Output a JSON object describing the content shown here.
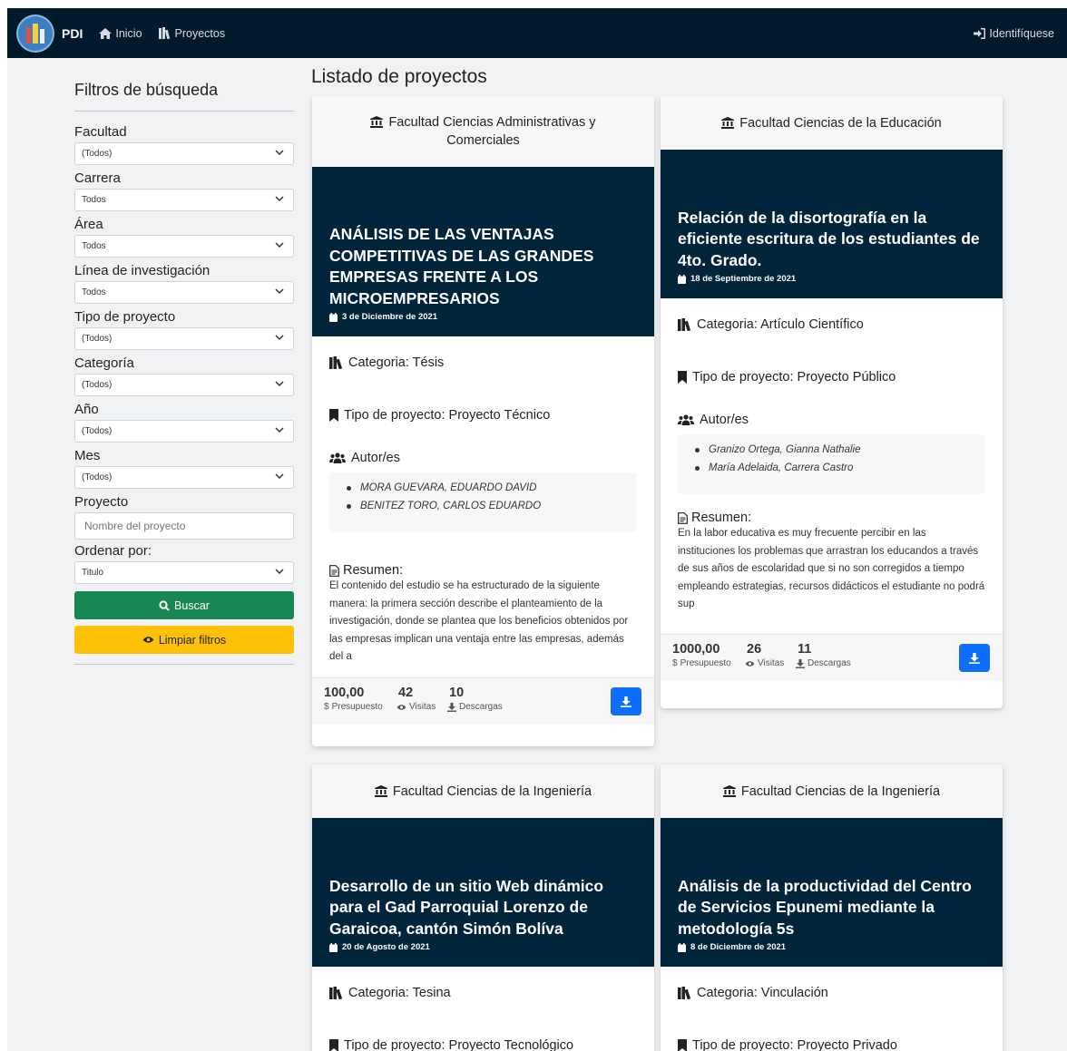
{
  "navbar": {
    "brand": "PDI",
    "links": [
      {
        "label": "Inicio",
        "icon": "home-icon"
      },
      {
        "label": "Proyectos",
        "icon": "books-icon"
      }
    ],
    "login_label": "Identifíquese"
  },
  "sidebar": {
    "title": "Filtros de búsqueda",
    "filters": [
      {
        "label": "Facultad",
        "value": "(Todos)"
      },
      {
        "label": "Carrera",
        "value": "Todos"
      },
      {
        "label": "Área",
        "value": "Todos"
      },
      {
        "label": "Línea de investigación",
        "value": "Todos"
      },
      {
        "label": "Tipo de proyecto",
        "value": "(Todos)"
      },
      {
        "label": "Categoría",
        "value": "(Todos)"
      },
      {
        "label": "Año",
        "value": "(Todos)"
      },
      {
        "label": "Mes",
        "value": "(Todos)"
      }
    ],
    "project_label": "Proyecto",
    "project_placeholder": "Nombre del proyecto",
    "order_label": "Ordenar por:",
    "order_value": "Titulo",
    "search_button": "Buscar",
    "clear_button": "Limpiar filtros"
  },
  "main": {
    "title": "Listado de proyectos",
    "labels": {
      "categoria_prefix": "Categoria: ",
      "tipo_prefix": "Tipo de proyecto: ",
      "autores": "Autor/es",
      "resumen": "Resumen:",
      "presupuesto": "Presupuesto",
      "visitas": "Visitas",
      "descargas": "Descargas"
    },
    "cards": [
      {
        "faculty": "Facultad Ciencias Administrativas y Comerciales",
        "title": "ANÁLISIS DE LAS VENTAJAS COMPETITIVAS DE LAS GRANDES EMPRESAS FRENTE A LOS MICROEMPRESARIOS",
        "date": "3 de Diciembre de 2021",
        "categoria": "Categoria: Tésis",
        "tipo": "Tipo de proyecto: Proyecto Técnico",
        "authors": [
          "MORA GUEVARA, EDUARDO DAVID",
          "BENITEZ TORO, CARLOS EDUARDO"
        ],
        "resumen": "El contenido del estudio se ha estructurado de la siguiente manera: la primera sección describe el planteamiento de la investigación, donde se plantea que los beneficios obtenidos por las empresas implican una ventaja entre las empresas, además del a",
        "presupuesto": "100,00",
        "visitas": "42",
        "descargas": "10"
      },
      {
        "faculty": "Facultad Ciencias de la Educación",
        "title": "Relación de la disortografía en la eficiente escritura de los estudiantes de 4to. Grado.",
        "date": "18 de Septiembre de 2021",
        "categoria": "Categoria: Artículo Científico",
        "tipo": "Tipo de proyecto: Proyecto Público",
        "authors": [
          "Granizo Ortega, Gianna Nathalie",
          "María Adelaida, Carrera Castro"
        ],
        "resumen": "En la labor educativa es muy frecuente percibir en las instituciones los problemas que arrastran los educandos a través de sus años de escolaridad que si no son corregidos a tiempo empleando estrategias, recursos didácticos el estudiante no podrá sup",
        "presupuesto": "1000,00",
        "visitas": "26",
        "descargas": "11"
      },
      {
        "faculty": "Facultad Ciencias de la Ingeniería",
        "title": "Desarrollo de un sitio Web dinámico para el Gad Parroquial Lorenzo de Garaicoa, cantón Simón Bolíva",
        "date": "20 de Agosto de 2021",
        "categoria": "Categoria: Tesina",
        "tipo": "Tipo de proyecto: Proyecto Tecnológico"
      },
      {
        "faculty": "Facultad Ciencias de la Ingeniería",
        "title": "Análisis de la productividad del Centro de Servicios Epunemi mediante la metodología 5s",
        "date": "8 de Diciembre de 2021",
        "categoria": "Categoria: Vinculación",
        "tipo": "Tipo de proyecto: Proyecto Privado"
      }
    ]
  },
  "colors": {
    "navbar": "#001a2b",
    "hero": "#00243a",
    "search_button": "#198754",
    "clear_button": "#ffc107",
    "download_button": "#0d6efd"
  }
}
